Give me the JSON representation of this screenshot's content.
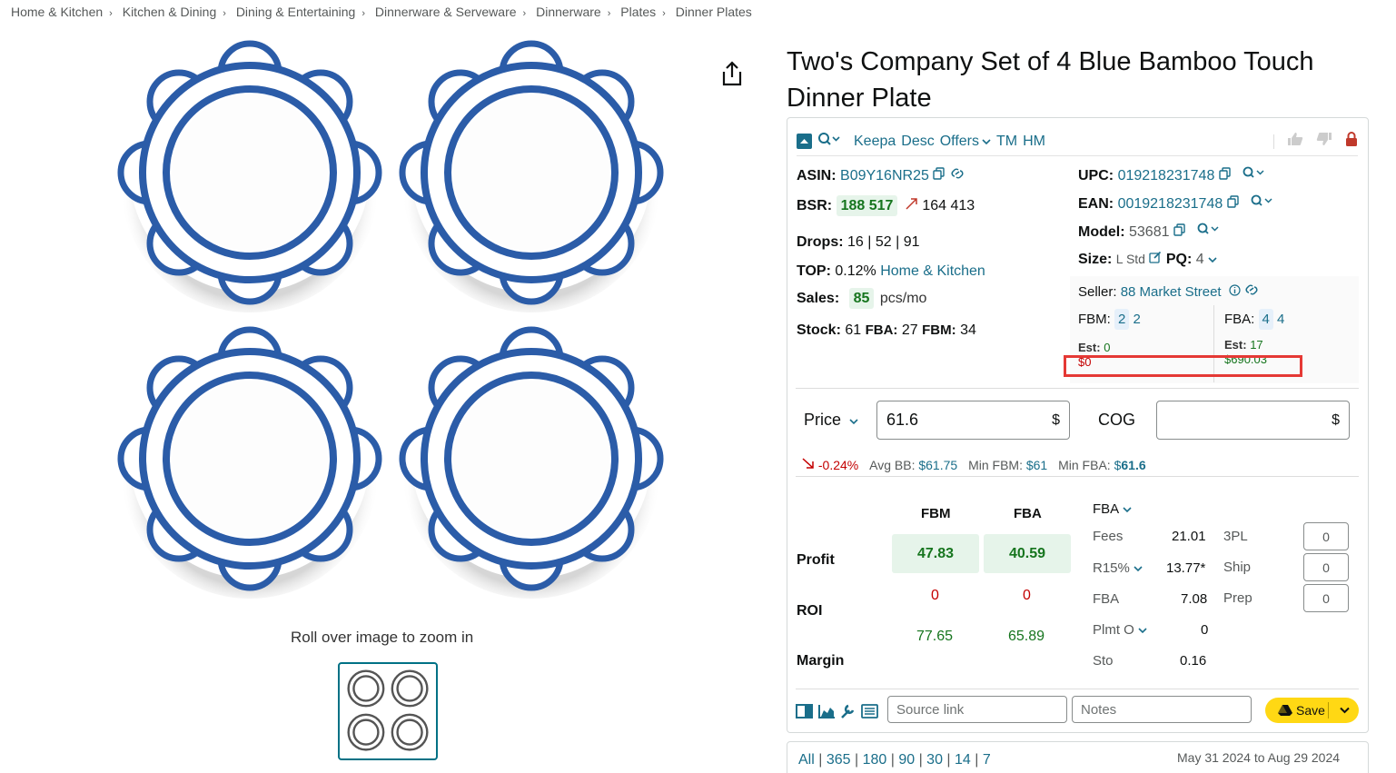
{
  "breadcrumb": [
    "Home & Kitchen",
    "Kitchen & Dining",
    "Dining & Entertaining",
    "Dinnerware & Serveware",
    "Dinnerware",
    "Plates",
    "Dinner Plates"
  ],
  "breadcrumb_sep": "›",
  "zoom_hint": "Roll over image to zoom in",
  "title": "Two's Company Set of 4 Blue Bamboo Touch Dinner Plate",
  "toolbar": {
    "keepa": "Keepa",
    "desc": "Desc",
    "offers": "Offers",
    "tm": "TM",
    "hm": "HM"
  },
  "left_stats": {
    "asin_label": "ASIN:",
    "asin": "B09Y16NR25",
    "bsr_label": "BSR:",
    "bsr": "188 517",
    "bsr_prev": "164 413",
    "drops_label": "Drops:",
    "drops": "16 | 52 | 91",
    "top_label": "TOP:",
    "top_pct": "0.12%",
    "top_cat": "Home & Kitchen",
    "sales_label": "Sales:",
    "sales": "85",
    "sales_unit": "pcs/mo",
    "stock_label": "Stock:",
    "stock": "61",
    "stock_fba_label": "FBA:",
    "stock_fba": "27",
    "stock_fbm_label": "FBM:",
    "stock_fbm": "34"
  },
  "right_stats": {
    "upc_label": "UPC:",
    "upc": "019218231748",
    "ean_label": "EAN:",
    "ean": "0019218231748",
    "model_label": "Model:",
    "model": "53681",
    "size_label": "Size:",
    "size": "L Std",
    "pq_label": "PQ:",
    "pq": "4",
    "seller_label": "Seller:",
    "seller": "88 Market Street",
    "fbm_label": "FBM:",
    "fbm_a": "2",
    "fbm_b": "2",
    "fba_label": "FBA:",
    "fba_a": "4",
    "fba_b": "4",
    "est_label_1": "Est:",
    "est_1": "0",
    "est_amount_1": "$0",
    "est_label_2": "Est:",
    "est_2": "17",
    "est_amount_2": "$690.03"
  },
  "price": {
    "label": "Price",
    "value": "61.6",
    "currency": "$",
    "cog_label": "COG",
    "cog_currency": "$"
  },
  "buybox": {
    "change": "-0.24%",
    "avg_bb_label": "Avg BB:",
    "avg_bb": "$61.75",
    "min_fbm_label": "Min FBM:",
    "min_fbm": "$61",
    "min_fba_label": "Min FBA:",
    "min_fba_prefix": "$",
    "min_fba": "61.6"
  },
  "calc": {
    "col_fbm": "FBM",
    "col_fba": "FBA",
    "profit_label": "Profit",
    "profit_fbm": "47.83",
    "profit_fba": "40.59",
    "roi_label": "ROI",
    "roi_fbm": "0",
    "roi_fba": "0",
    "margin_label": "Margin",
    "margin_fbm": "77.65",
    "margin_fba": "65.89"
  },
  "fees": {
    "mode": "FBA",
    "rows": [
      {
        "label": "Fees",
        "value": "21.01"
      },
      {
        "label": "R15%",
        "value": "13.77*"
      },
      {
        "label": "FBA",
        "value": "7.08"
      },
      {
        "label": "Plmt O",
        "value": "0"
      },
      {
        "label": "Sto",
        "value": "0.16"
      }
    ],
    "extras": [
      {
        "label": "3PL",
        "value": "0"
      },
      {
        "label": "Ship",
        "value": "0"
      },
      {
        "label": "Prep",
        "value": "0"
      }
    ]
  },
  "bottom": {
    "source_placeholder": "Source link",
    "notes_placeholder": "Notes",
    "save_label": "Save"
  },
  "ranges": {
    "links": [
      "All",
      "365",
      "180",
      "90",
      "30",
      "14",
      "7"
    ],
    "date_range": "May 31 2024 to Aug 29 2024"
  },
  "colors": {
    "accent": "#007185",
    "green": "#16751e",
    "red": "#c40000",
    "highlight": "#e53935",
    "save": "#ffd814"
  }
}
